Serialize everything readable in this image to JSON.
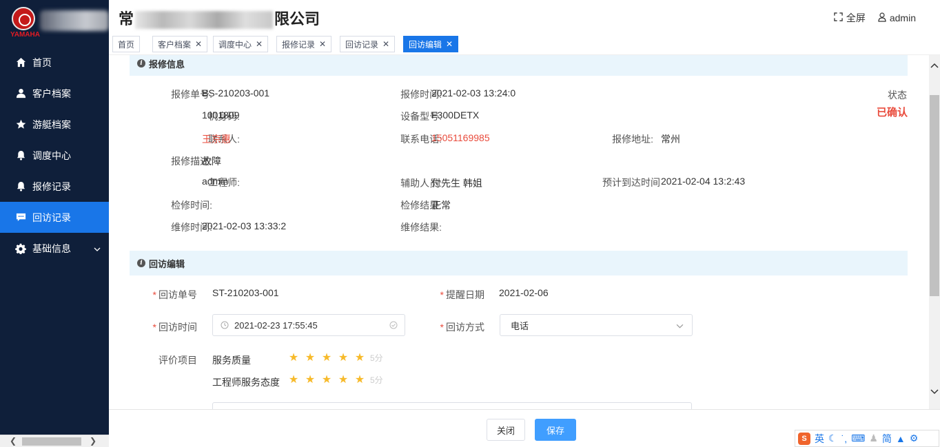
{
  "sidebar": {
    "logo_text": "YAMAHA",
    "items": [
      {
        "label": "首页",
        "icon": "home-icon"
      },
      {
        "label": "客户档案",
        "icon": "user-icon"
      },
      {
        "label": "游艇档案",
        "icon": "star-icon"
      },
      {
        "label": "调度中心",
        "icon": "bell-icon"
      },
      {
        "label": "报修记录",
        "icon": "bell-icon"
      },
      {
        "label": "回访记录",
        "icon": "chat-icon",
        "active": true
      },
      {
        "label": "基础信息",
        "icon": "gear-icon",
        "expandable": true
      }
    ]
  },
  "header": {
    "company_start": "常",
    "company_end": "限公司",
    "fullscreen_label": "全屏",
    "user_label": "admin"
  },
  "tabs": [
    {
      "label": "首页",
      "closable": false
    },
    {
      "label": "客户档案",
      "closable": true
    },
    {
      "label": "调度中心",
      "closable": true
    },
    {
      "label": "报修记录",
      "closable": true
    },
    {
      "label": "回访记录",
      "closable": true
    },
    {
      "label": "回访编辑",
      "closable": true,
      "active": true
    }
  ],
  "repair_info": {
    "section_title": "报修信息",
    "order_no_label": "报修单号:",
    "order_no": "BS-210203-001",
    "repair_time_label": "报修时间:",
    "repair_time": "2021-02-03 13:24:0",
    "status_label": "状态",
    "status_value": "已确认",
    "serial_label": "机身码:",
    "serial": "1001809",
    "model_label": "设备型号:",
    "model": "F300DETX",
    "contact_label": "联系人:",
    "contact": "王京惠",
    "phone_label": "联系电话:",
    "phone": "15051169985",
    "address_label": "报修地址:",
    "address": "常州",
    "desc_label": "报修描述:",
    "desc": "故障",
    "engineer_label": "工程师:",
    "engineer": "admin",
    "assistant_label": "辅助人员:",
    "assistant": "付先生 韩姐",
    "eta_label": "预计到达时间",
    "eta": "2021-02-04 13:2:43",
    "inspect_time_label": "检修时间:",
    "inspect_time": "",
    "inspect_result_label": "检修结果:",
    "inspect_result": "正常",
    "maint_time_label": "维修时间:",
    "maint_time": "2021-02-03 13:33:2",
    "maint_result_label": "维修结果:",
    "maint_result": ""
  },
  "visit_edit": {
    "section_title": "回访编辑",
    "visit_no_label": "回访单号",
    "visit_no": "ST-210203-001",
    "remind_date_label": "提醒日期",
    "remind_date": "2021-02-06",
    "visit_time_label": "回访时间",
    "visit_time": "2021-02-23 17:55:45",
    "visit_method_label": "回访方式",
    "visit_method": "电话",
    "rating_label": "评价项目",
    "ratings": [
      {
        "name": "服务质量",
        "stars": 5,
        "score_text": "5分"
      },
      {
        "name": "工程师服务态度",
        "stars": 5,
        "score_text": "5分"
      }
    ]
  },
  "footer": {
    "close_label": "关闭",
    "save_label": "保存"
  },
  "ime": {
    "lang": "英",
    "mode": "简"
  },
  "colors": {
    "sidebar_bg": "#0f1f3a",
    "accent": "#1976e8",
    "primary_button": "#409eff",
    "danger": "#e94b3c",
    "star": "#f7ba2a",
    "section_bg": "#e9f5fc"
  }
}
